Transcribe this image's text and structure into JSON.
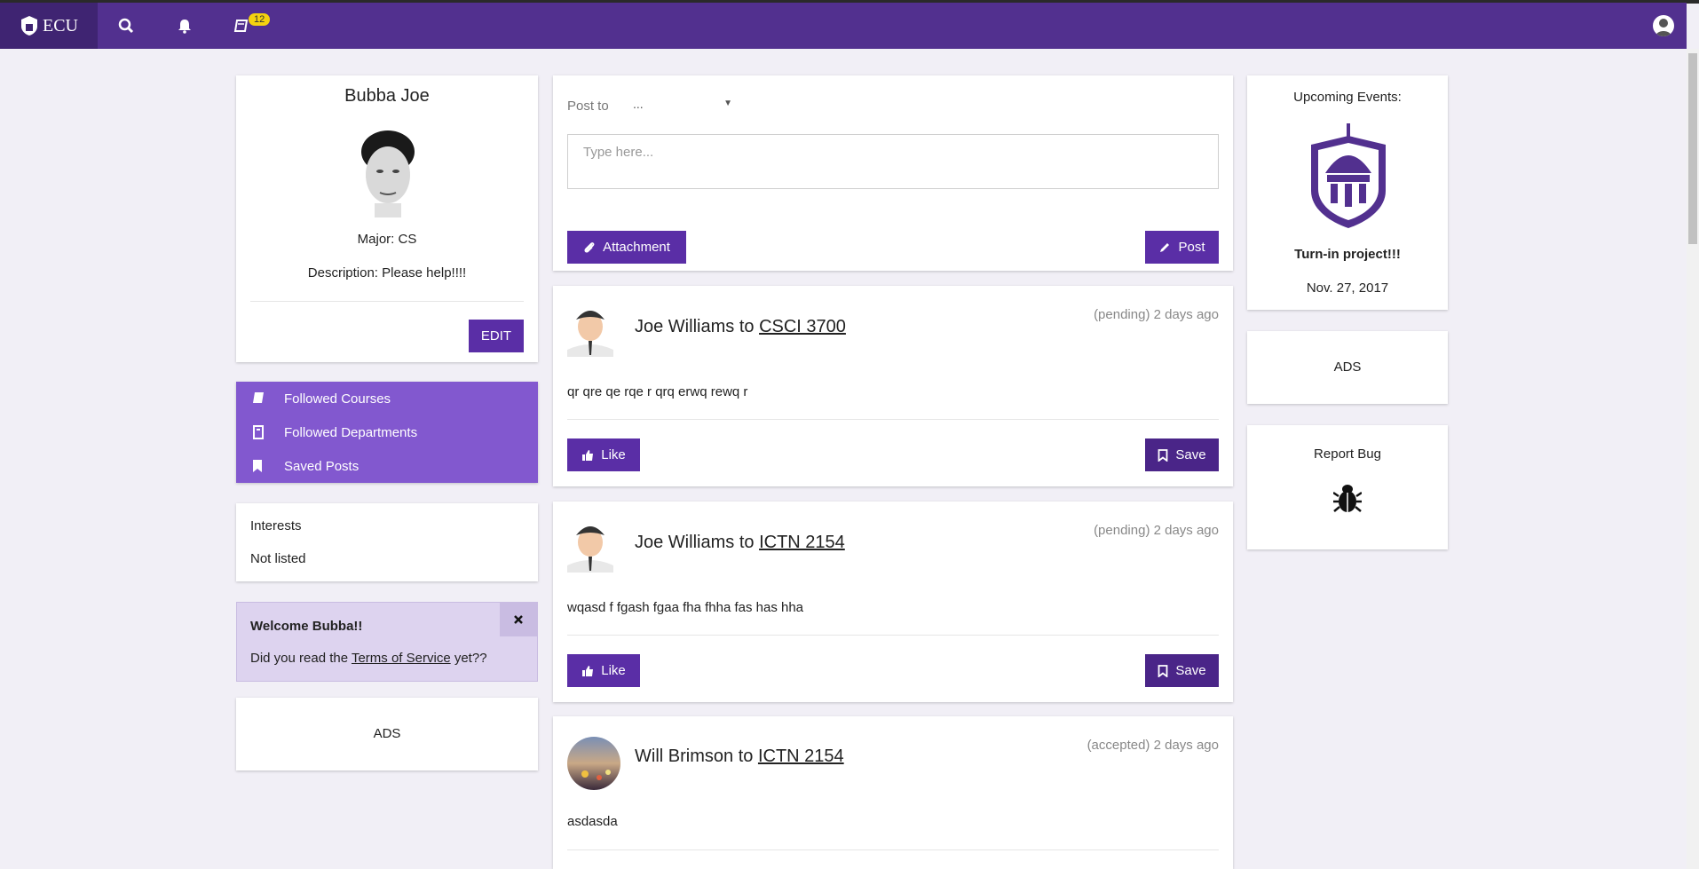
{
  "nav": {
    "logo_text": "ECU",
    "badge_count": "12",
    "brand_color": "#52308f"
  },
  "profile": {
    "name": "Bubba Joe",
    "major": "Major: CS",
    "description": "Description: Please help!!!!",
    "edit_label": "EDIT"
  },
  "sidebar_menu": {
    "items": [
      {
        "label": "Followed Courses",
        "icon": "book-icon"
      },
      {
        "label": "Followed Departments",
        "icon": "building-icon"
      },
      {
        "label": "Saved Posts",
        "icon": "bookmark-icon"
      }
    ]
  },
  "interests": {
    "title": "Interests",
    "value": "Not listed"
  },
  "welcome": {
    "title": "Welcome Bubba!!",
    "text_before": "Did you read the ",
    "link": "Terms of Service",
    "text_after": " yet??"
  },
  "left_ads": "ADS",
  "composer": {
    "post_to_label": "Post to",
    "post_to_value": "...",
    "placeholder": "Type here...",
    "attachment_label": "Attachment",
    "post_label": "Post"
  },
  "posts": [
    {
      "author": "Joe Williams",
      "to": "to",
      "course": "CSCI 3700",
      "status": "(pending) 2 days ago",
      "body": "qr qre qe rqe r qrq erwq rewq r",
      "like": "Like",
      "save": "Save"
    },
    {
      "author": "Joe Williams",
      "to": "to",
      "course": "ICTN 2154",
      "status": "(pending) 2 days ago",
      "body": "wqasd f fgash fgaa fha fhha fas has hha",
      "like": "Like",
      "save": "Save"
    },
    {
      "author": "Will Brimson",
      "to": "to",
      "course": "ICTN 2154",
      "status": "(accepted) 2 days ago",
      "body": "asdasda"
    }
  ],
  "events": {
    "title": "Upcoming Events:",
    "name": "Turn-in project!!!",
    "date": "Nov. 27, 2017"
  },
  "right_ads": "ADS",
  "report_bug": {
    "label": "Report Bug"
  }
}
